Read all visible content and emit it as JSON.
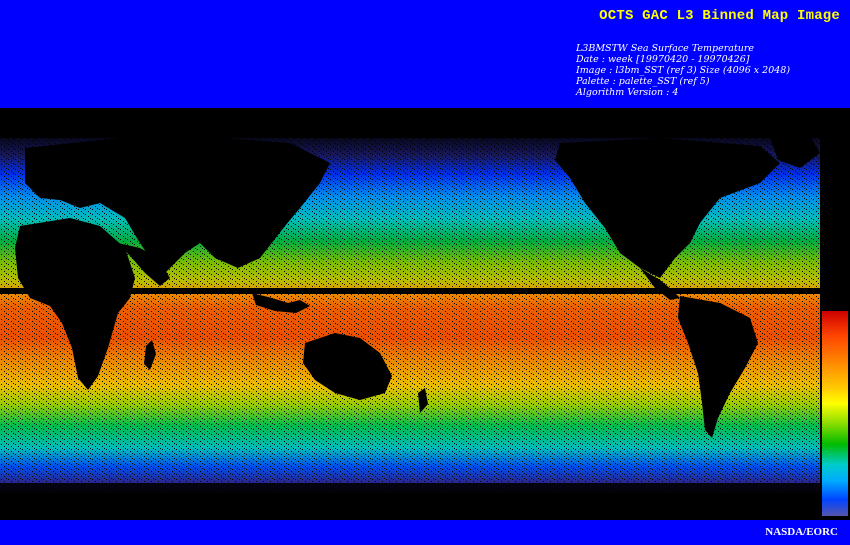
{
  "header": {
    "title": "OCTS GAC L3 Binned Map Image",
    "meta_lines": [
      "L3BMSTW Sea Surface Temperature",
      "Date : week [19970420 - 19970426]",
      "Image : l3bm_SST (ref 3) Size (4096 x 2048)",
      "Palette : palette_SST (ref 5)",
      "Algorithm Version : 4"
    ]
  },
  "map": {
    "variable": "Sea Surface Temperature",
    "projection": "equirectangular global",
    "land_color": "#000000",
    "colorbar_colors": [
      "#cc0000",
      "#ff4400",
      "#ff8800",
      "#ffcc00",
      "#ffff00",
      "#88dd00",
      "#00bb00",
      "#00cccc",
      "#00aaff",
      "#0044ff",
      "#5555aa"
    ]
  },
  "footer": {
    "credit": "NASDA/EORC"
  },
  "colors": {
    "banner": "#0000ff",
    "title": "#ffff00",
    "text": "#ffffff",
    "background": "#000000"
  }
}
